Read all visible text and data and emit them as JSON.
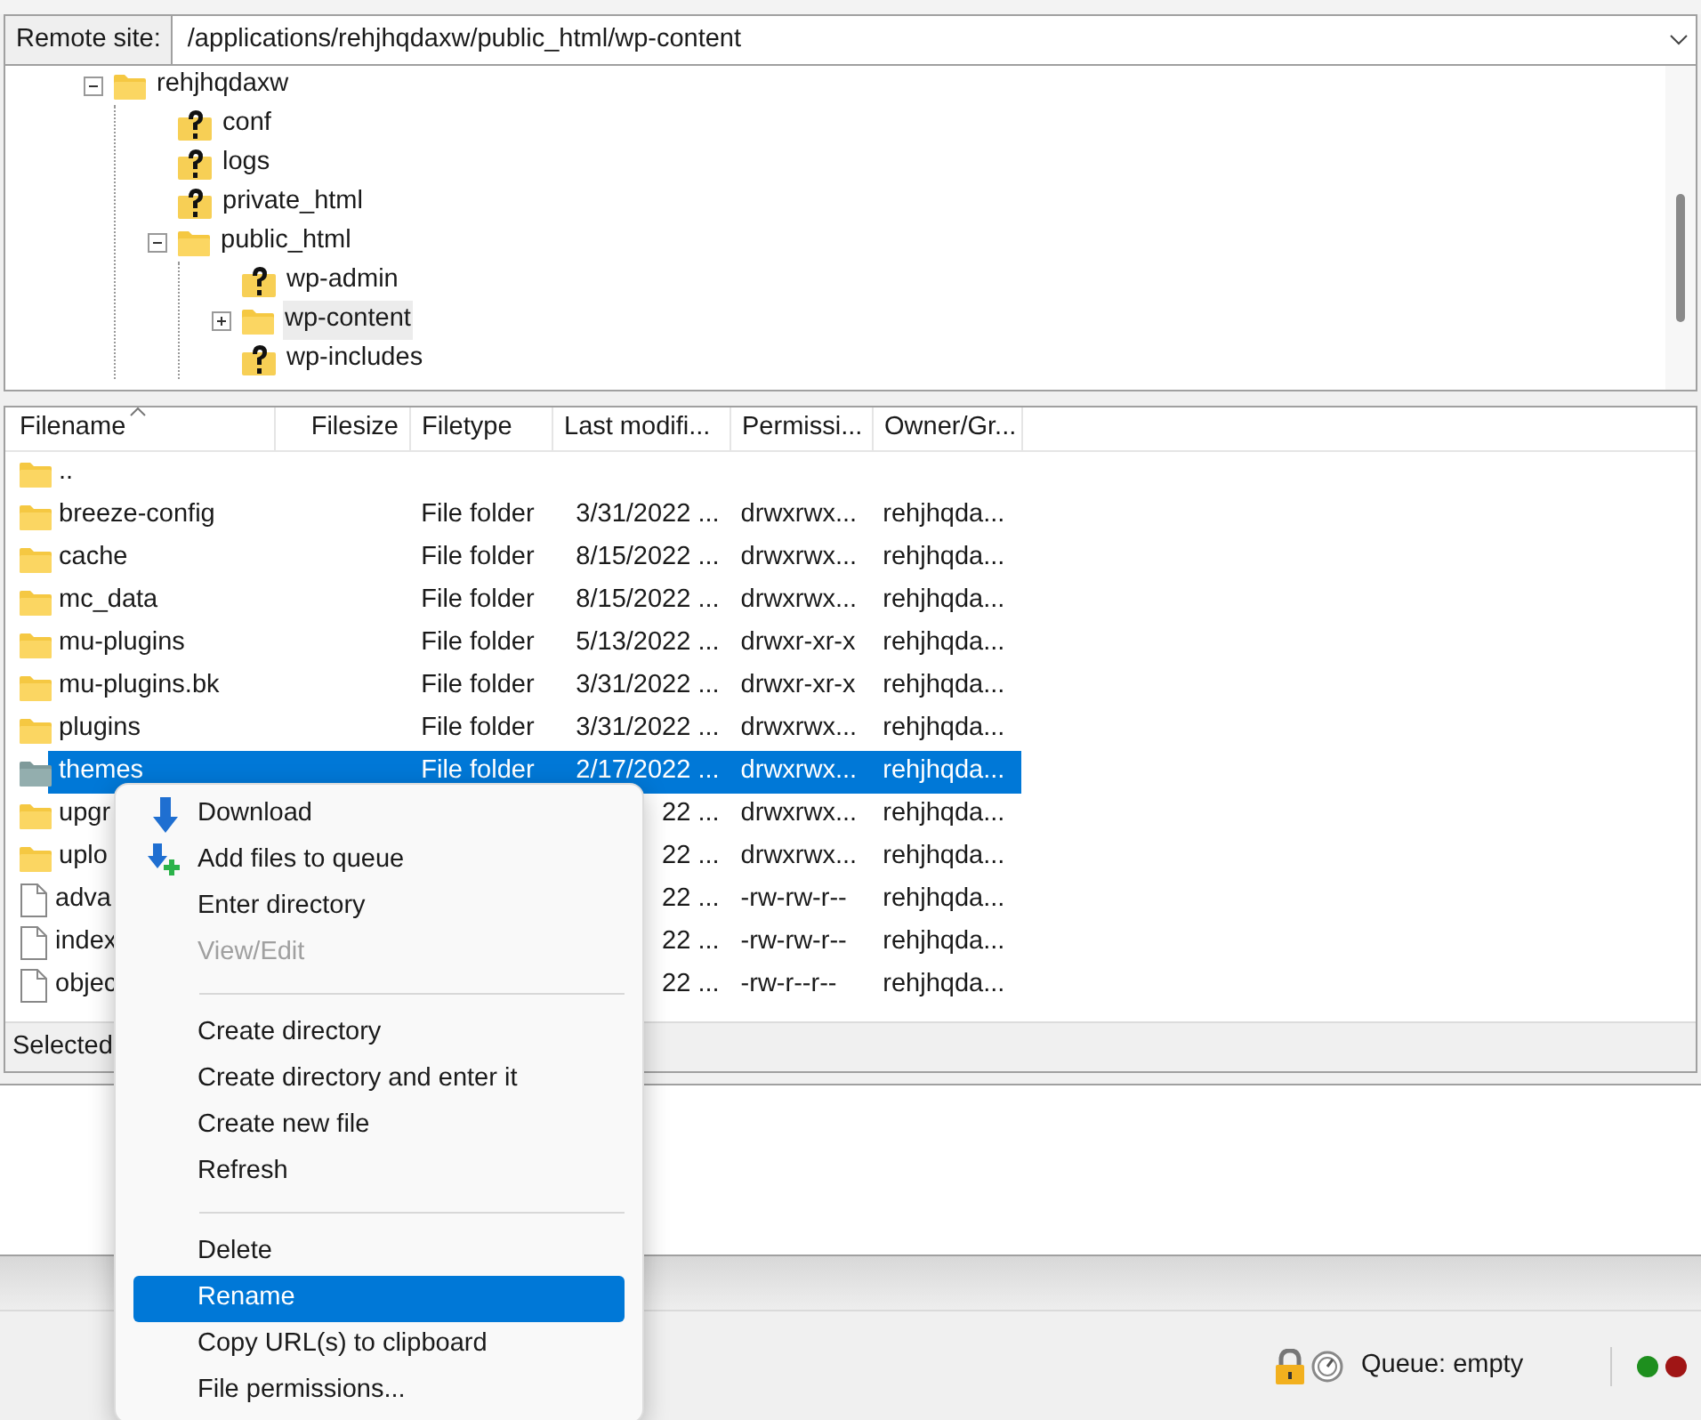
{
  "remote_site": {
    "label": "Remote site:",
    "path": "/applications/rehjhqdaxw/public_html/wp-content"
  },
  "tree": [
    {
      "name": "rehjhqdaxw",
      "kind": "folder",
      "selected": false,
      "expanded": true,
      "children": [
        {
          "name": "conf",
          "kind": "unknown",
          "selected": false
        },
        {
          "name": "logs",
          "kind": "unknown",
          "selected": false
        },
        {
          "name": "private_html",
          "kind": "unknown",
          "selected": false
        },
        {
          "name": "public_html",
          "kind": "folder",
          "selected": false,
          "expanded": true,
          "children": [
            {
              "name": "wp-admin",
              "kind": "unknown",
              "selected": false
            },
            {
              "name": "wp-content",
              "kind": "folder",
              "selected": true,
              "expanded": false
            },
            {
              "name": "wp-includes",
              "kind": "unknown",
              "selected": false
            }
          ]
        }
      ]
    }
  ],
  "file_list": {
    "columns": [
      "Filename",
      "Filesize",
      "Filetype",
      "Last modifi...",
      "Permissi...",
      "Owner/Gr..."
    ],
    "rows": [
      {
        "kind": "folder",
        "selected": false,
        "name": "..",
        "type": "",
        "modified": "",
        "permissions": "",
        "owner": ""
      },
      {
        "kind": "folder",
        "selected": false,
        "name": "breeze-config",
        "type": "File folder",
        "modified": "3/31/2022 ...",
        "permissions": "drwxrwx...",
        "owner": "rehjhqda..."
      },
      {
        "kind": "folder",
        "selected": false,
        "name": "cache",
        "type": "File folder",
        "modified": "8/15/2022 ...",
        "permissions": "drwxrwx...",
        "owner": "rehjhqda..."
      },
      {
        "kind": "folder",
        "selected": false,
        "name": "mc_data",
        "type": "File folder",
        "modified": "8/15/2022 ...",
        "permissions": "drwxrwx...",
        "owner": "rehjhqda..."
      },
      {
        "kind": "folder",
        "selected": false,
        "name": "mu-plugins",
        "type": "File folder",
        "modified": "5/13/2022 ...",
        "permissions": "drwxr-xr-x",
        "owner": "rehjhqda..."
      },
      {
        "kind": "folder",
        "selected": false,
        "name": "mu-plugins.bk",
        "type": "File folder",
        "modified": "3/31/2022 ...",
        "permissions": "drwxr-xr-x",
        "owner": "rehjhqda..."
      },
      {
        "kind": "folder",
        "selected": false,
        "name": "plugins",
        "type": "File folder",
        "modified": "3/31/2022 ...",
        "permissions": "drwxrwx...",
        "owner": "rehjhqda..."
      },
      {
        "kind": "folder",
        "selected": true,
        "name": "themes",
        "type": "File folder",
        "modified": "2/17/2022 ...",
        "permissions": "drwxrwx...",
        "owner": "rehjhqda..."
      },
      {
        "kind": "folder",
        "selected": false,
        "name": "upgr",
        "type": "",
        "modified": "22 ...",
        "permissions": "drwxrwx...",
        "owner": "rehjhqda..."
      },
      {
        "kind": "folder",
        "selected": false,
        "name": "uplo",
        "type": "",
        "modified": "22 ...",
        "permissions": "drwxrwx...",
        "owner": "rehjhqda..."
      },
      {
        "kind": "file",
        "selected": false,
        "name": "adva",
        "type": "",
        "modified": "22 ...",
        "permissions": "-rw-rw-r--",
        "owner": "rehjhqda..."
      },
      {
        "kind": "file",
        "selected": false,
        "name": "index",
        "type": "",
        "modified": "22 ...",
        "permissions": "-rw-rw-r--",
        "owner": "rehjhqda..."
      },
      {
        "kind": "file",
        "selected": false,
        "name": "objec",
        "type": "",
        "modified": "22 ...",
        "permissions": "-rw-r--r--",
        "owner": "rehjhqda..."
      }
    ],
    "status": "Selected"
  },
  "context_menu": [
    {
      "kind": "download",
      "label": "Download",
      "disabled": false,
      "selected": false
    },
    {
      "kind": "enqueue",
      "label": "Add files to queue",
      "disabled": false,
      "selected": false
    },
    {
      "kind": "item",
      "label": "Enter directory",
      "disabled": false,
      "selected": false
    },
    {
      "kind": "item",
      "label": "View/Edit",
      "disabled": true,
      "selected": false
    },
    {
      "kind": "separator"
    },
    {
      "kind": "item",
      "label": "Create directory",
      "disabled": false,
      "selected": false
    },
    {
      "kind": "item",
      "label": "Create directory and enter it",
      "disabled": false,
      "selected": false
    },
    {
      "kind": "item",
      "label": "Create new file",
      "disabled": false,
      "selected": false
    },
    {
      "kind": "item",
      "label": "Refresh",
      "disabled": false,
      "selected": false
    },
    {
      "kind": "separator"
    },
    {
      "kind": "item",
      "label": "Delete",
      "disabled": false,
      "selected": false
    },
    {
      "kind": "item",
      "label": "Rename",
      "disabled": false,
      "selected": true
    },
    {
      "kind": "item",
      "label": "Copy URL(s) to clipboard",
      "disabled": false,
      "selected": false
    },
    {
      "kind": "item",
      "label": "File permissions...",
      "disabled": false,
      "selected": false
    }
  ],
  "status_bar": {
    "queue": "Queue: empty",
    "lights": [
      {
        "color": "#1e8f1e"
      },
      {
        "color": "#a01515"
      }
    ]
  }
}
